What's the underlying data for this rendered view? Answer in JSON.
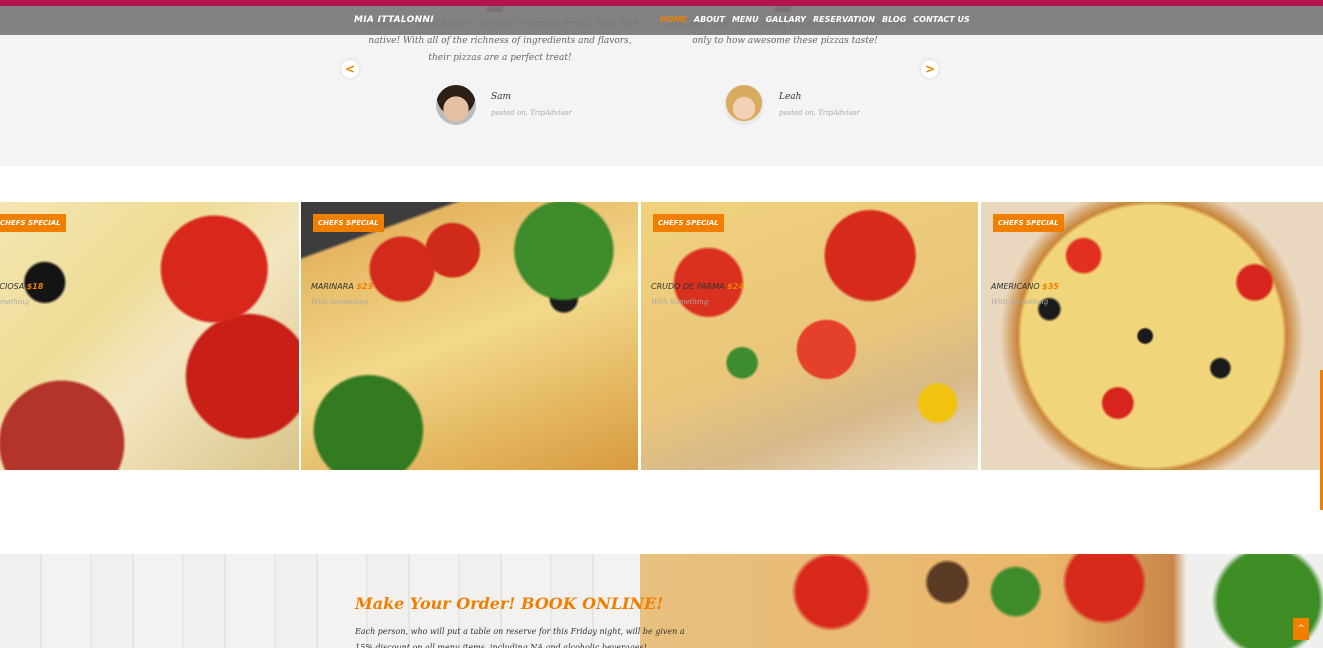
{
  "navbar": {
    "brand": "MIA ITTALONNI",
    "items": [
      "HOME",
      "ABOUT",
      "MENU",
      "GALLARY",
      "RESERVATION",
      "BLOG",
      "CONTACT US"
    ]
  },
  "testimonials": {
    "left": {
      "text": "...a pizza so good before, and this is coming from a New York native! With all of the richness of ingredients and flavors, their pizzas are a perfect treat!",
      "name": "Sam",
      "source": "posted on, TripAdvisor"
    },
    "right": {
      "text": "...best one here! Their pizza variety is ultimate, inferior only to how awesome these pizzas taste!",
      "name": "Leah",
      "source": "posted on, TripAdvisor"
    },
    "prev_label": "<",
    "next_label": ">"
  },
  "menu": {
    "items": [
      {
        "badge": "CHEFS SPECIAL",
        "name": "CAPRICCIOSA",
        "price": "$18",
        "sub": "With Something"
      },
      {
        "badge": "CHEFS SPECIAL",
        "name": "MARINARA",
        "price": "$23",
        "sub": "With Something"
      },
      {
        "badge": "CHEFS SPECIAL",
        "name": "CRUDO DE PARMA",
        "price": "$24",
        "sub": "With Something"
      },
      {
        "badge": "CHEFS SPECIAL",
        "name": "AMERICANO",
        "price": "$35",
        "sub": "With Something"
      }
    ]
  },
  "order": {
    "title": "Make Your Order! BOOK ONLINE!",
    "body": "Each person, who will put a table on reserve for this Friday night, will be given a 15% discount on all menu items, including NA and alcoholic beverages!"
  },
  "scroll_top_label": "^",
  "colors": {
    "accent": "#f07f00",
    "brand_bar": "#b3124e"
  }
}
